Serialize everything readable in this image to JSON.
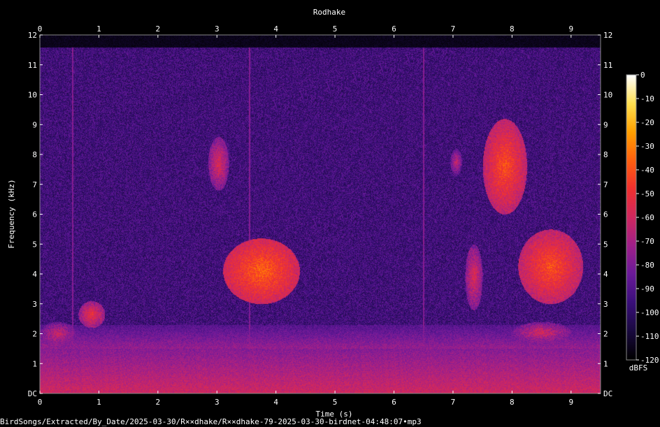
{
  "chart_data": {
    "type": "heatmap",
    "title": "Rodhake",
    "xlabel": "Time (s)",
    "ylabel": "Frequency (kHz)",
    "xlim": [
      0,
      9.5
    ],
    "ylim": [
      0,
      12
    ],
    "x_ticks": [
      "0",
      "1",
      "2",
      "3",
      "4",
      "5",
      "6",
      "7",
      "8",
      "9"
    ],
    "y_ticks": [
      "DC",
      "1",
      "2",
      "3",
      "4",
      "5",
      "6",
      "7",
      "8",
      "9",
      "10",
      "11",
      "12"
    ],
    "colorbar": {
      "label": "dBFS",
      "range": [
        -120,
        0
      ],
      "ticks": [
        "0",
        "-10",
        "-20",
        "-30",
        "-40",
        "-50",
        "-60",
        "-70",
        "-80",
        "-90",
        "-100",
        "-110",
        "-120"
      ],
      "colors": [
        "#000000",
        "#1a0a40",
        "#3a0f7a",
        "#6a1a9a",
        "#a0208a",
        "#d02860",
        "#f03030",
        "#ff6010",
        "#ffa000",
        "#ffe050",
        "#ffffff"
      ]
    },
    "background_level_db": -95,
    "low_freq_band": {
      "freq_top_khz": 1.5,
      "level_db": -60
    },
    "signal_cutoff_khz": 11.6,
    "events": [
      {
        "t0": 0.0,
        "t1": 0.6,
        "f0": 1.6,
        "f1": 2.4,
        "peak_db": -60
      },
      {
        "t0": 0.65,
        "t1": 1.1,
        "f0": 2.2,
        "f1": 3.1,
        "peak_db": -50
      },
      {
        "t0": 2.85,
        "t1": 3.2,
        "f0": 6.8,
        "f1": 8.6,
        "peak_db": -55
      },
      {
        "t0": 3.1,
        "t1": 4.4,
        "f0": 3.0,
        "f1": 5.2,
        "peak_db": -35
      },
      {
        "t0": 6.95,
        "t1": 7.15,
        "f0": 7.3,
        "f1": 8.2,
        "peak_db": -62
      },
      {
        "t0": 7.2,
        "t1": 7.5,
        "f0": 2.8,
        "f1": 5.0,
        "peak_db": -55
      },
      {
        "t0": 7.5,
        "t1": 8.25,
        "f0": 6.0,
        "f1": 9.2,
        "peak_db": -40
      },
      {
        "t0": 8.1,
        "t1": 9.2,
        "f0": 3.0,
        "f1": 5.5,
        "peak_db": -40
      },
      {
        "t0": 8.0,
        "t1": 9.0,
        "f0": 1.7,
        "f1": 2.4,
        "peak_db": -58
      }
    ],
    "transients_s": [
      0.55,
      3.55,
      6.5
    ]
  },
  "footer": {
    "path": "BirdSongs/Extracted/By_Date/2025-03-30/R××dhake/R××dhake-79-2025-03-30-birdnet-04:48:07•mp3"
  }
}
